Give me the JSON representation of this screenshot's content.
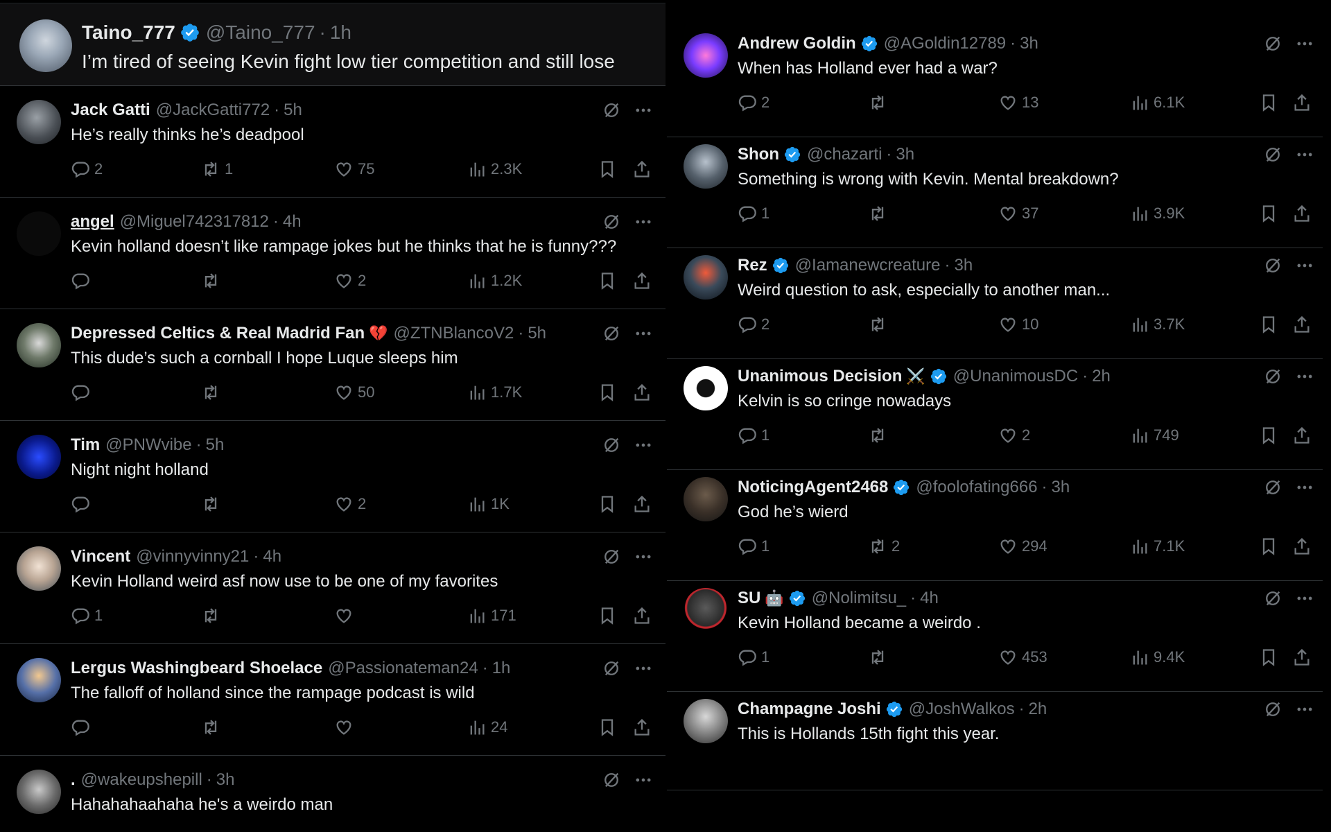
{
  "focus_post": {
    "name": "Taino_777",
    "handle": "@Taino_777",
    "time": "1h",
    "text": "I’m tired of seeing Kevin fight low tier competition and still lose"
  },
  "left_replies": [
    {
      "name": "Jack Gatti",
      "handle": "@JackGatti772",
      "time": "5h",
      "text": "He’s really thinks he’s deadpool",
      "replies": "2",
      "reposts": "1",
      "likes": "75",
      "views": "2.3K"
    },
    {
      "name": "angel",
      "handle": "@Miguel742317812",
      "time": "4h",
      "text": "Kevin holland doesn’t like rampage jokes but he thinks that he is funny???",
      "replies": "",
      "reposts": "",
      "likes": "2",
      "views": "1.2K"
    },
    {
      "name": "Depressed Celtics & Real Madrid Fan",
      "emoji": "💔",
      "handle": "@ZTNBlancoV2",
      "time": "5h",
      "text": "This dude’s such a cornball I hope Luque sleeps him",
      "replies": "",
      "reposts": "",
      "likes": "50",
      "views": "1.7K"
    },
    {
      "name": "Tim",
      "handle": "@PNWvibe",
      "time": "5h",
      "text": "Night night holland",
      "replies": "",
      "reposts": "",
      "likes": "2",
      "views": "1K"
    },
    {
      "name": "Vincent",
      "handle": "@vinnyvinny21",
      "time": "4h",
      "text": "Kevin Holland weird asf now use to be one of my favorites",
      "replies": "1",
      "reposts": "",
      "likes": "",
      "views": "171"
    },
    {
      "name": "Lergus Washingbeard Shoelace",
      "handle": "@Passionateman24",
      "time": "1h",
      "text": "The falloff of holland since the rampage podcast is wild",
      "replies": "",
      "reposts": "",
      "likes": "",
      "views": "24"
    },
    {
      "name": ".",
      "handle": "@wakeupshepill",
      "time": "3h",
      "text": "Hahahahaahaha he's a weirdo man"
    }
  ],
  "right_replies": [
    {
      "name": "Andrew Goldin",
      "handle": "@AGoldin12789",
      "time": "3h",
      "text": "When has Holland ever had a war?",
      "replies": "2",
      "reposts": "",
      "likes": "13",
      "views": "6.1K"
    },
    {
      "name": "Shon",
      "handle": "@chazarti",
      "time": "3h",
      "text": "Something is wrong with Kevin. Mental breakdown?",
      "replies": "1",
      "reposts": "",
      "likes": "37",
      "views": "3.9K"
    },
    {
      "name": "Rez",
      "handle": "@Iamanewcreature",
      "time": "3h",
      "text": "Weird question to ask, especially to another man...",
      "replies": "2",
      "reposts": "",
      "likes": "10",
      "views": "3.7K"
    },
    {
      "name": "Unanimous Decision",
      "emoji": "⚔️",
      "handle": "@UnanimousDC",
      "time": "2h",
      "text": "Kelvin is so cringe nowadays",
      "replies": "1",
      "reposts": "",
      "likes": "2",
      "views": "749"
    },
    {
      "name": "NoticingAgent2468",
      "handle": "@foolofating666",
      "time": "3h",
      "text": "God he’s wierd",
      "replies": "1",
      "reposts": "2",
      "likes": "294",
      "views": "7.1K"
    },
    {
      "name": "SU",
      "emoji": "🤖",
      "handle": "@Nolimitsu_",
      "time": "4h",
      "text": "Kevin Holland became a weirdo .",
      "replies": "1",
      "reposts": "",
      "likes": "453",
      "views": "9.4K"
    },
    {
      "name": "Champagne Joshi",
      "handle": "@JoshWalkos",
      "time": "2h",
      "text": "This is Hollands 15th fight this year."
    }
  ],
  "separator": "·",
  "icons": {
    "verified": "verified-badge-icon",
    "grok": "grok-icon",
    "more": "more-icon",
    "reply": "reply-icon",
    "repost": "repost-icon",
    "like": "like-icon",
    "views": "views-icon",
    "bookmark": "bookmark-icon",
    "share": "share-icon"
  },
  "colors": {
    "background": "#000000",
    "text": "#e7e9ea",
    "muted": "#71767b",
    "verified": "#1d9bf0",
    "divider": "#2f3336"
  }
}
